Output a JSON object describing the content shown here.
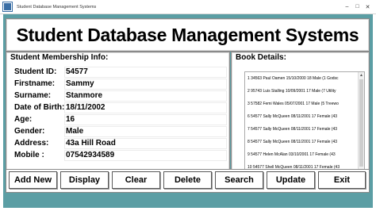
{
  "window": {
    "title": "Student Database Management Systems",
    "icons": {
      "app": "app-icon",
      "minimize": "minimize-icon",
      "maximize": "maximize-icon",
      "close": "close-icon"
    }
  },
  "header": {
    "title": "Student Database Management Systems"
  },
  "membership": {
    "label": "Student Membership Info:",
    "fields": [
      {
        "label": "Student ID:",
        "value": "54577"
      },
      {
        "label": "Firstname:",
        "value": "Sammy"
      },
      {
        "label": "Surname:",
        "value": "Stanmore"
      },
      {
        "label": "Date of Birth:",
        "value": "18/11/2002"
      },
      {
        "label": "Age:",
        "value": "16"
      },
      {
        "label": "Gender:",
        "value": "Male"
      },
      {
        "label": "Address:",
        "value": "43a Hill Road"
      },
      {
        "label": "Mobile :",
        "value": "07542934589"
      }
    ]
  },
  "book_details": {
    "label": "Book Details:",
    "items": [
      "1 34563 Paul Oamen 15/10/2000 18 Male (1 Godsc",
      "2 95743 Luis Stalling 10/09/2001 17 Male (7 Utility",
      "3 57582 Femi Wales 05/07/2001 17 Male (5 Treewo",
      "6 54577 Sally McQueen 08/11/2001 17 Female (43",
      "7 54577 Sally McQueen 08/11/2001 17 Female (43",
      "8 54577 Sally McQueen 08/11/2001 17 Female (43",
      "9 54577 Helen McAlan 03/10/2001 17 Female (43",
      "10 54577 Shell McQueen 08/11/2001 17 Female (43"
    ]
  },
  "buttons": {
    "add_new": "Add New",
    "display": "Display",
    "clear": "Clear",
    "delete": "Delete",
    "search": "Search",
    "update": "Update",
    "exit": "Exit"
  },
  "colors": {
    "app_background": "#5b9ea4",
    "panel": "#ffffff"
  }
}
